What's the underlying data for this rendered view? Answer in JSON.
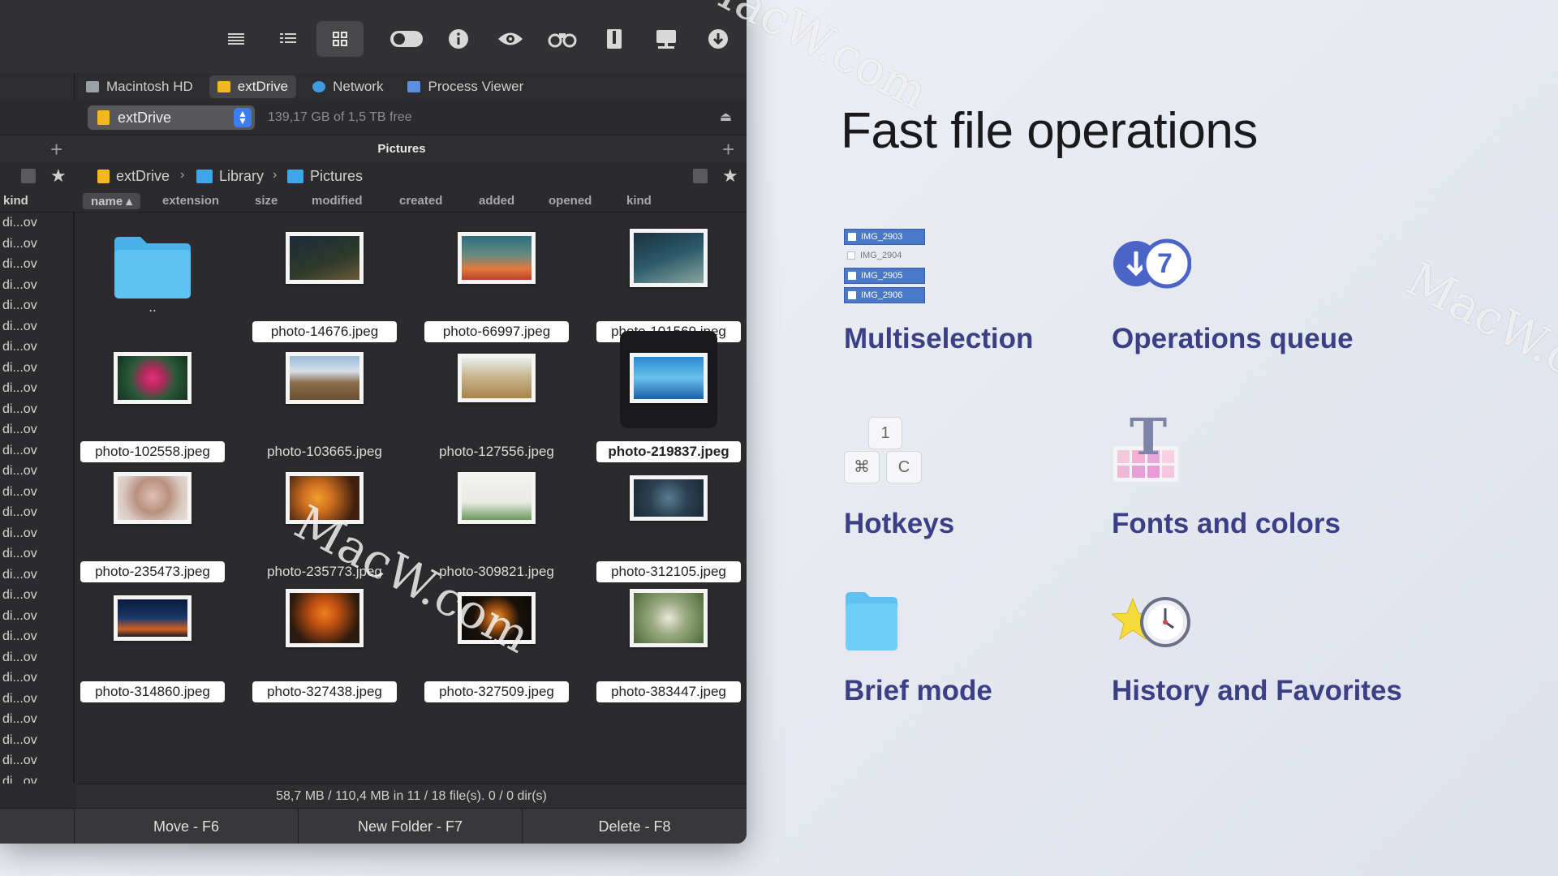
{
  "toolbar": {
    "buttons": [
      "list-view-icon",
      "detailed-view-icon",
      "thumbnail-view-icon",
      "toggle-icon",
      "info-icon",
      "preview-eye-icon",
      "search-binoculars-icon",
      "archive-icon",
      "network-share-icon",
      "download-icon"
    ],
    "active": "thumbnail-view-icon"
  },
  "volumes": [
    {
      "label": "Macintosh HD",
      "color": "#9aa0a8"
    },
    {
      "label": "extDrive",
      "color": "#f2b81d"
    },
    {
      "label": "Network",
      "color": "#3f9be0"
    },
    {
      "label": "Process Viewer",
      "color": "#5b8de0"
    }
  ],
  "drive": {
    "name": "extDrive",
    "free": "139,17 GB of 1,5 TB free"
  },
  "panel": {
    "title": "Pictures"
  },
  "path": {
    "segments": [
      "extDrive",
      "Library",
      "Pictures"
    ],
    "separator": "›"
  },
  "columns": {
    "left": "kind",
    "headers": [
      "name",
      "extension",
      "size",
      "modified",
      "created",
      "added",
      "opened",
      "kind"
    ]
  },
  "left_rows": "di...ov",
  "files": [
    {
      "name": "..",
      "kind": "folder"
    },
    {
      "name": "photo-14676.jpeg"
    },
    {
      "name": "photo-66997.jpeg"
    },
    {
      "name": "photo-101569.jpeg"
    },
    {
      "name": "photo-102558.jpeg"
    },
    {
      "name": "photo-103665.jpeg"
    },
    {
      "name": "photo-127556.jpeg"
    },
    {
      "name": "photo-219837.jpeg",
      "selected": true
    },
    {
      "name": "photo-235473.jpeg"
    },
    {
      "name": "photo-235773.jpeg"
    },
    {
      "name": "photo-309821.jpeg"
    },
    {
      "name": "photo-312105.jpeg"
    },
    {
      "name": "photo-314860.jpeg"
    },
    {
      "name": "photo-327438.jpeg"
    },
    {
      "name": "photo-327509.jpeg"
    },
    {
      "name": "photo-383447.jpeg"
    }
  ],
  "status": "58,7 MB / 110,4 MB in 11 / 18 file(s). 0 / 0 dir(s)",
  "fkeys": [
    "Move - F6",
    "New Folder - F7",
    "Delete - F8"
  ],
  "headline": "Fast file operations",
  "features": {
    "multiselection": {
      "label": "Multiselection",
      "items": [
        "IMG_2903",
        "IMG_2904",
        "IMG_2905",
        "IMG_2906"
      ]
    },
    "queue": {
      "label": "Operations queue",
      "count": "7"
    },
    "hotkeys": {
      "label": "Hotkeys",
      "keys": [
        "1",
        "⌘",
        "C"
      ]
    },
    "fonts": {
      "label": "Fonts and colors",
      "glyph": "T"
    },
    "brief": {
      "label": "Brief mode"
    },
    "history": {
      "label": "History and Favorites"
    }
  },
  "watermark": "MacW.com",
  "colors": {
    "accent": "#3b3f86",
    "selection_blue": "#3c7df0",
    "folder": "#4fb6ee"
  }
}
